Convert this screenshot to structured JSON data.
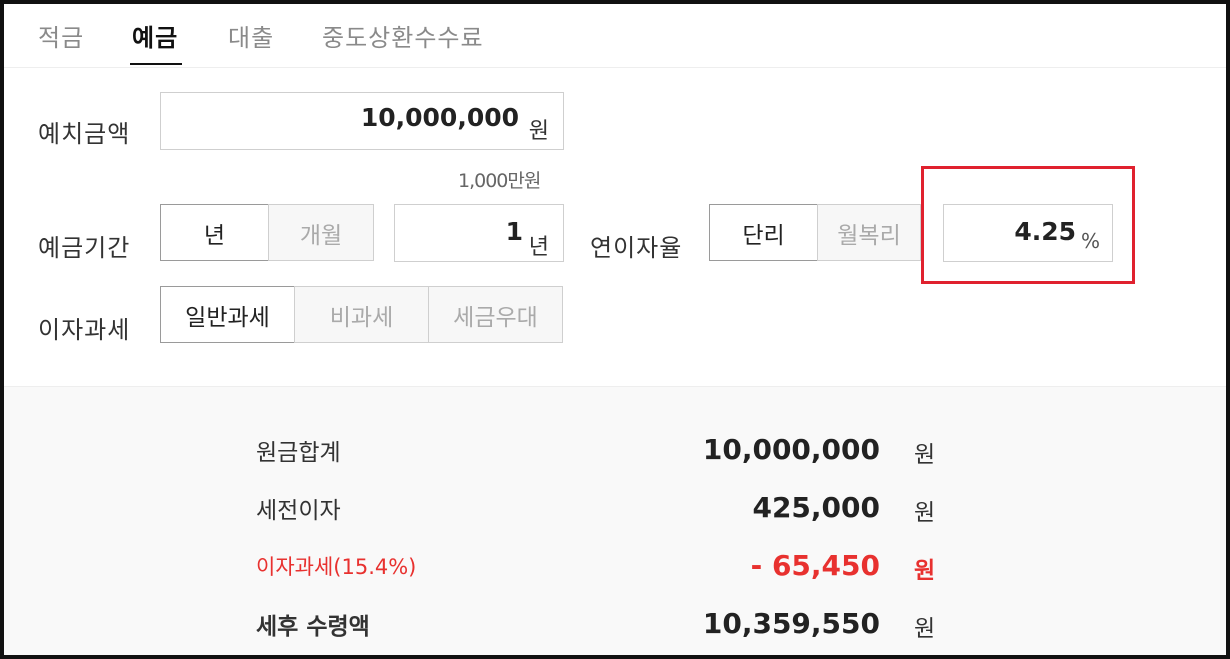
{
  "tabs": [
    {
      "label": "적금",
      "active": false
    },
    {
      "label": "예금",
      "active": true
    },
    {
      "label": "대출",
      "active": false
    },
    {
      "label": "중도상환수수료",
      "active": false
    }
  ],
  "deposit": {
    "label": "예치금액",
    "value": "10,000,000",
    "unit": "원",
    "hint": "1,000만원"
  },
  "period": {
    "label": "예금기간",
    "options": [
      "년",
      "개월"
    ],
    "selected": "년",
    "value": "1",
    "unit": "년"
  },
  "rate": {
    "label": "연이자율",
    "options": [
      "단리",
      "월복리"
    ],
    "selected": "단리",
    "value": "4.25",
    "unit": "%"
  },
  "tax": {
    "label": "이자과세",
    "options": [
      "일반과세",
      "비과세",
      "세금우대"
    ],
    "selected": "일반과세"
  },
  "results": [
    {
      "label": "원금합계",
      "value": "10,000,000",
      "unit": "원"
    },
    {
      "label": "세전이자",
      "value": "425,000",
      "unit": "원"
    },
    {
      "label": "이자과세(15.4%)",
      "value": "- 65,450",
      "unit": "원"
    },
    {
      "label": "세후 수령액",
      "value": "10,359,550",
      "unit": "원"
    }
  ],
  "colors": {
    "accent_red": "#e8312f",
    "highlight_border": "#e0212f"
  }
}
